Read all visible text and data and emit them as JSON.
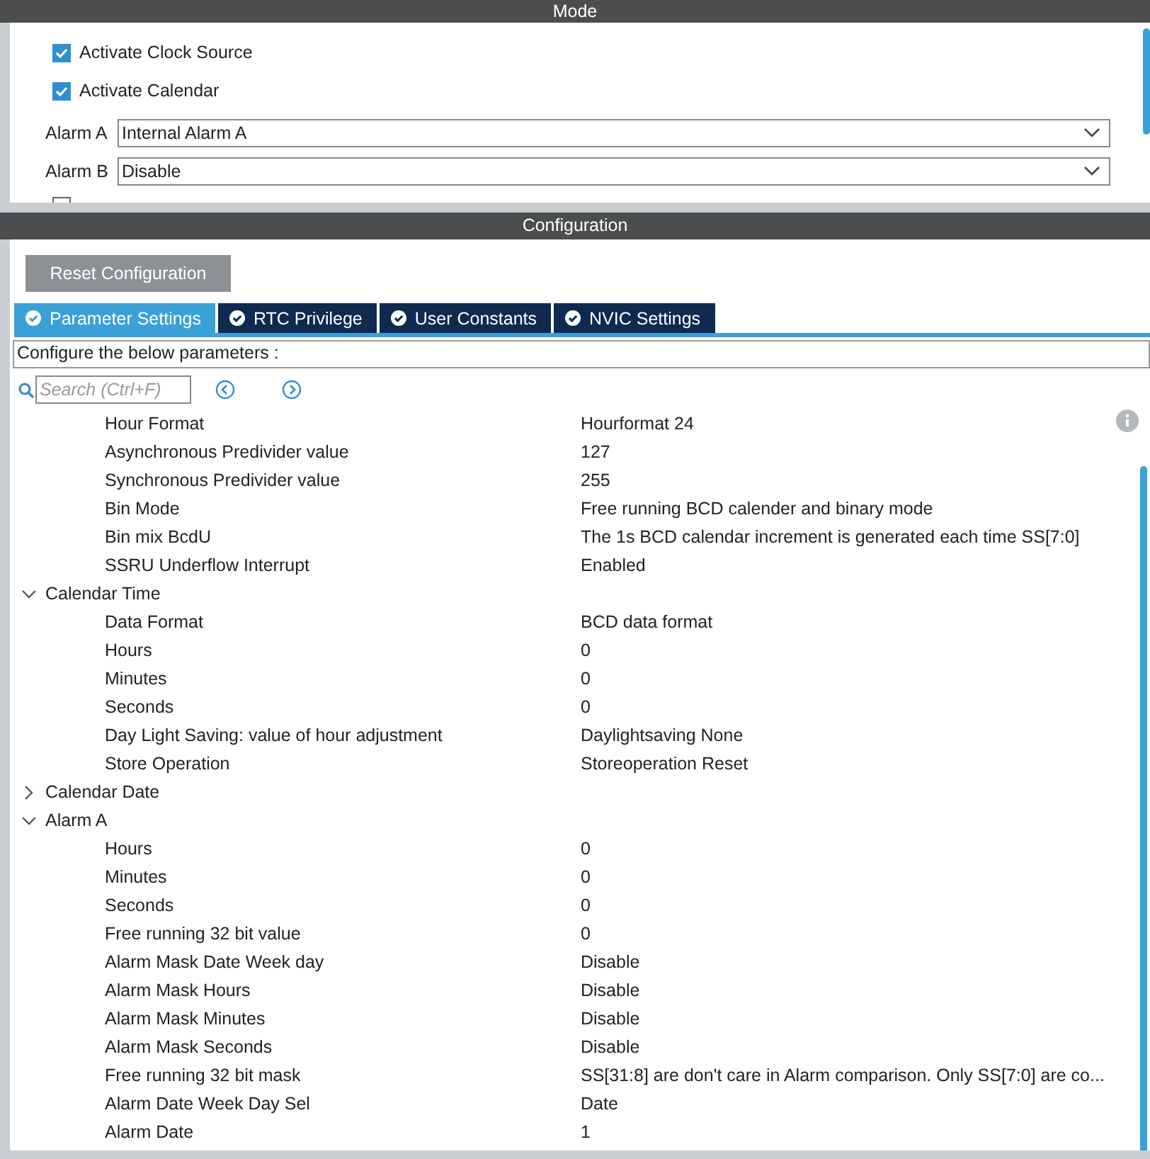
{
  "mode": {
    "title": "Mode",
    "checkboxes": [
      {
        "label": "Activate Clock Source",
        "checked": true
      },
      {
        "label": "Activate Calendar",
        "checked": true
      },
      {
        "checked": false
      }
    ],
    "dropdowns": [
      {
        "label": "Alarm A",
        "value": "Internal Alarm A"
      },
      {
        "label": "Alarm B",
        "value": "Disable"
      }
    ]
  },
  "configuration": {
    "title": "Configuration",
    "reset_button": "Reset Configuration",
    "tabs": [
      {
        "label": "Parameter Settings",
        "selected": true
      },
      {
        "label": "RTC Privilege",
        "selected": false
      },
      {
        "label": "User Constants",
        "selected": false
      },
      {
        "label": "NVIC Settings",
        "selected": false
      }
    ],
    "hint": "Configure the below parameters :",
    "search": {
      "placeholder": "Search (Ctrl+F)"
    },
    "parameters": [
      {
        "children": [
          {
            "label": "Hour Format",
            "value": "Hourformat 24"
          },
          {
            "label": "Asynchronous Predivider value",
            "value": "127"
          },
          {
            "label": "Synchronous Predivider value",
            "value": "255"
          },
          {
            "label": "Bin Mode",
            "value": "Free running BCD calender and binary mode"
          },
          {
            "label": "Bin mix BcdU",
            "value": "The 1s BCD calendar increment is generated each time SS[7:0]"
          },
          {
            "label": "SSRU Underflow Interrupt",
            "value": "Enabled"
          }
        ]
      },
      {
        "label": "Calendar Time",
        "expanded": true,
        "children": [
          {
            "label": "Data Format",
            "value": "BCD data format"
          },
          {
            "label": "Hours",
            "value": "0"
          },
          {
            "label": "Minutes",
            "value": "0"
          },
          {
            "label": "Seconds",
            "value": "0"
          },
          {
            "label": "Day Light Saving: value of hour adjustment",
            "value": "Daylightsaving None"
          },
          {
            "label": "Store Operation",
            "value": "Storeoperation Reset"
          }
        ]
      },
      {
        "label": "Calendar Date",
        "expanded": false
      },
      {
        "label": "Alarm A",
        "expanded": true,
        "children": [
          {
            "label": "Hours",
            "value": "0"
          },
          {
            "label": "Minutes",
            "value": "0"
          },
          {
            "label": "Seconds",
            "value": "0"
          },
          {
            "label": "Free running 32 bit value",
            "value": "0"
          },
          {
            "label": "Alarm Mask Date Week day",
            "value": "Disable"
          },
          {
            "label": "Alarm Mask Hours",
            "value": "Disable"
          },
          {
            "label": "Alarm Mask Minutes",
            "value": "Disable"
          },
          {
            "label": "Alarm Mask Seconds",
            "value": "Disable"
          },
          {
            "label": "Free running 32 bit mask",
            "value": "SS[31:8] are don't care in Alarm comparison. Only SS[7:0] are co..."
          },
          {
            "label": "Alarm Date Week Day Sel",
            "value": "Date"
          },
          {
            "label": "Alarm Date",
            "value": "1"
          }
        ]
      }
    ]
  }
}
